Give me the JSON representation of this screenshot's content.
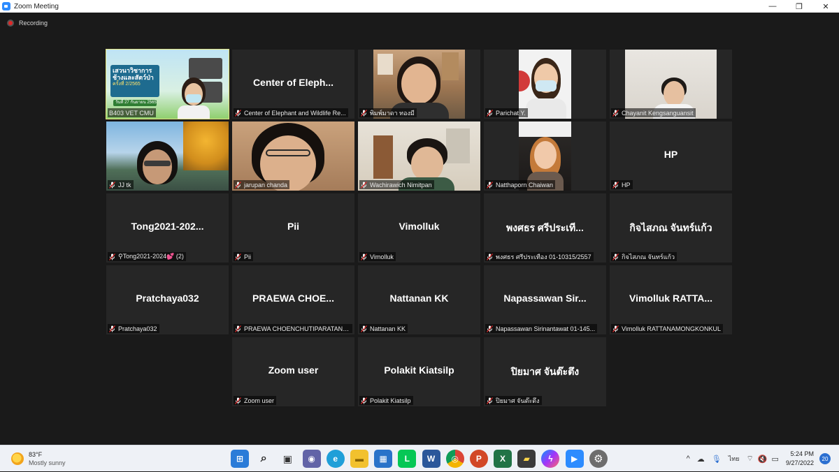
{
  "window": {
    "title": "Zoom Meeting",
    "controls": [
      "—",
      "❐",
      "✕"
    ]
  },
  "recording": {
    "label": "Recording"
  },
  "tiles": [
    {
      "label": "B403 VET CMU",
      "video": true,
      "active": true,
      "muted": false
    },
    {
      "big": "Center of Eleph...",
      "label": "Center of Elephant and Wildlife Re...",
      "muted": true
    },
    {
      "label": "พิมพ์มาดา ทองมี",
      "video": true,
      "muted": true
    },
    {
      "label": "Parichat Y.",
      "video": true,
      "muted": true
    },
    {
      "label": "Chayanit Kengsanguansit",
      "video": true,
      "muted": true
    },
    {
      "label": "JJ tk",
      "video": true,
      "muted": true
    },
    {
      "label": "jarupan chanda",
      "video": true,
      "muted": true
    },
    {
      "label": "Wachirawich Nimitpan",
      "video": true,
      "muted": true
    },
    {
      "label": "Natthaporn Chaiwan",
      "video": true,
      "muted": true
    },
    {
      "big": "HP",
      "label": "HP",
      "muted": true
    },
    {
      "big": "Tong2021-202...",
      "label": "⚲Tong2021-2024💕 (2)",
      "muted": true
    },
    {
      "big": "Pii",
      "label": "Pii",
      "muted": true
    },
    {
      "big": "Vimolluk",
      "label": "Vimolluk",
      "muted": true
    },
    {
      "big": "พงศธร ศรีประเที...",
      "label": "พงศธร ศรีประเทือง 01-10315/2557",
      "muted": true
    },
    {
      "big": "กิจไสภณ จันทร์แก้ว",
      "label": "กิจไสภณ จันทร์แก้ว",
      "muted": true
    },
    {
      "big": "Pratchaya032",
      "label": "Pratchaya032",
      "muted": true
    },
    {
      "big": "PRAEWA  CHOE...",
      "label": "PRAEWA CHOENCHUTIPARATANA...",
      "muted": true
    },
    {
      "big": "Nattanan KK",
      "label": "Nattanan KK",
      "muted": true
    },
    {
      "big": "Napassawan  Sir...",
      "label": "Napassawan Sirinantawat 01-145...",
      "muted": true
    },
    {
      "big": "Vimolluk  RATTA...",
      "label": "Vimolluk RATTANAMONGKONKUL",
      "muted": true
    },
    {
      "big": "Zoom user",
      "label": "Zoom user",
      "muted": true
    },
    {
      "big": "Polakit Kiatsilp",
      "label": "Polakit Kiatsilp",
      "muted": true
    },
    {
      "big": "ปิยมาศ จันต๊ะตึง",
      "label": "ปิยมาศ จันต๊ะตึง",
      "muted": true
    }
  ],
  "slide": {
    "title": "เสวนาวิชาการ ช้างและสัตว์ป่า",
    "sub": "ครั้งที่ 2/2565",
    "date": "วันที่ 27 กันยายน 2565"
  },
  "taskbar": {
    "weather_temp": "83°F",
    "weather_cond": "Mostly sunny",
    "apps": [
      {
        "name": "start-icon",
        "color": "#2b7cd8",
        "glyph": "⊞"
      },
      {
        "name": "search-icon",
        "color": "transparent",
        "glyph": "⌕"
      },
      {
        "name": "task-view-icon",
        "color": "#333333",
        "glyph": "▣"
      },
      {
        "name": "teams-chat-icon",
        "color": "#6264a7",
        "glyph": "◉"
      },
      {
        "name": "edge-icon",
        "color": "#1f9fd8",
        "glyph": "e"
      },
      {
        "name": "file-explorer-icon",
        "color": "#f2c12e",
        "glyph": "▬"
      },
      {
        "name": "store-icon",
        "color": "#2a73c9",
        "glyph": "▦"
      },
      {
        "name": "line-icon",
        "color": "#06c755",
        "glyph": "L"
      },
      {
        "name": "word-icon",
        "color": "#2b579a",
        "glyph": "W"
      },
      {
        "name": "chrome-icon",
        "color": "#e6a513",
        "glyph": "◎"
      },
      {
        "name": "powerpoint-icon",
        "color": "#d24726",
        "glyph": "P"
      },
      {
        "name": "excel-icon",
        "color": "#217346",
        "glyph": "X"
      },
      {
        "name": "sticky-notes-icon",
        "color": "#3a3a3a",
        "glyph": "▰"
      },
      {
        "name": "messenger-icon",
        "color": "#7b5cf4",
        "glyph": "ϟ"
      },
      {
        "name": "zoom-icon",
        "color": "#2d8cff",
        "glyph": "▶"
      },
      {
        "name": "settings-icon",
        "color": "#6d6d6d",
        "glyph": "⚙"
      }
    ],
    "tray_up": "^",
    "lang": "ไทย",
    "time": "5:24 PM",
    "date": "9/27/2022",
    "notifications": "20"
  }
}
